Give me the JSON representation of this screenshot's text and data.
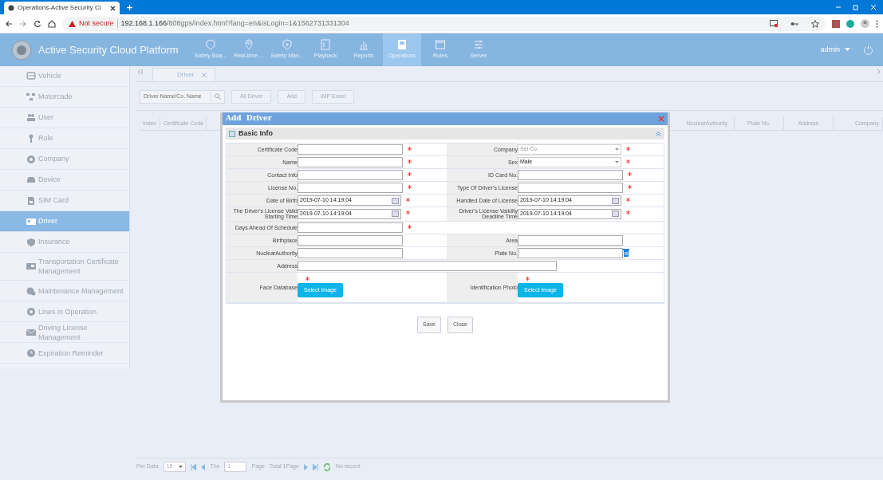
{
  "browser": {
    "tab_title": "Operations-Active Security Cl",
    "address": {
      "warning": "Not secure",
      "host": "192.168.1.166",
      "path": "/808gps/index.html?lang=en&isLogin=1&1562731331304"
    }
  },
  "app": {
    "title": "Active Security Cloud Platform",
    "user": "admin",
    "nav": [
      {
        "label": "Safety Boa...",
        "selected": false
      },
      {
        "label": "Real-time ...",
        "selected": false
      },
      {
        "label": "Safety Man...",
        "selected": false
      },
      {
        "label": "Playback",
        "selected": false
      },
      {
        "label": "Reports",
        "selected": false
      },
      {
        "label": "Operations",
        "selected": true
      },
      {
        "label": "Rules",
        "selected": false
      },
      {
        "label": "Server",
        "selected": false
      }
    ]
  },
  "sidebar": {
    "items": [
      {
        "label": "Vehicle",
        "selected": false
      },
      {
        "label": "Motorcade",
        "selected": false
      },
      {
        "label": "User",
        "selected": false
      },
      {
        "label": "Role",
        "selected": false
      },
      {
        "label": "Company",
        "selected": false
      },
      {
        "label": "Device",
        "selected": false
      },
      {
        "label": "SIM Card",
        "selected": false
      },
      {
        "label": "Driver",
        "selected": true
      },
      {
        "label": "Insurance",
        "selected": false
      },
      {
        "label": "Transportation Certificate Management",
        "selected": false
      },
      {
        "label": "Maintenance Management",
        "selected": false
      },
      {
        "label": "Lines in Operation",
        "selected": false
      },
      {
        "label": "Driving License Management",
        "selected": false
      },
      {
        "label": "Expiration Reminder",
        "selected": false
      }
    ]
  },
  "content_tab": {
    "label": "Driver"
  },
  "toolbar": {
    "search": {
      "placeholder": "Driver Name/Co. Name"
    },
    "buttons": [
      "All Driver",
      "Add",
      "IMP Excel"
    ]
  },
  "table": {
    "left_columns": [
      "Index",
      "Certificate Code"
    ],
    "right_columns": [
      "NuclearAuthority",
      "Plate No.",
      "Address",
      "Company"
    ]
  },
  "pager": {
    "per_data_label": "Per Data",
    "per_data": "15",
    "the_label": "The",
    "page": "1",
    "page_label": "Page",
    "total": "Total 1Page",
    "status": "No record"
  },
  "dialog": {
    "title": "Add  Driver",
    "section": "Basic Info",
    "rows": [
      [
        {
          "label": "Certificate Code",
          "kind": "text",
          "required": true
        },
        {
          "label": "Company",
          "kind": "select",
          "placeholder": "Sel Co.",
          "required": true
        }
      ],
      [
        {
          "label": "Name",
          "kind": "text",
          "required": true
        },
        {
          "label": "Sex",
          "kind": "select",
          "value": "Male",
          "required": true
        }
      ],
      [
        {
          "label": "Contact Info",
          "kind": "text",
          "required": true
        },
        {
          "label": "ID Card No.",
          "kind": "text",
          "required": true
        }
      ],
      [
        {
          "label": "License No.",
          "kind": "text",
          "required": true
        },
        {
          "label": "Type Of Driver's License",
          "kind": "text",
          "required": true
        }
      ],
      [
        {
          "label": "Date of Birth",
          "kind": "date",
          "value": "2019-07-10 14:19:04",
          "required": true
        },
        {
          "label": "Handled Date of License",
          "kind": "date",
          "value": "2019-07-10 14:19:04",
          "required": true
        }
      ],
      [
        {
          "label": "The Driver's License Valid Starting Time",
          "kind": "date",
          "value": "2019-07-10 14:19:04",
          "required": true
        },
        {
          "label": "Driver's License Validity Deadline Time",
          "kind": "date",
          "value": "2019-07-10 14:19:04",
          "required": true
        }
      ],
      [
        {
          "label": "Days Ahead Of Schedule",
          "kind": "text",
          "required": true
        }
      ],
      [
        {
          "label": "Birthplace",
          "kind": "text",
          "required": false
        },
        {
          "label": "Area",
          "kind": "text",
          "required": false
        }
      ],
      [
        {
          "label": "NuclearAuthority",
          "kind": "text",
          "required": false
        },
        {
          "label": "Plate No.",
          "kind": "clearable",
          "required": false
        }
      ],
      [
        {
          "label": "Address",
          "kind": "wide",
          "required": false
        }
      ],
      [
        {
          "label": "Face Database",
          "kind": "image",
          "button": "Select Image",
          "required": true
        },
        {
          "label": "Identification Photo",
          "kind": "image",
          "button": "Select Image",
          "required": true
        }
      ]
    ],
    "buttons": [
      "Save",
      "Close"
    ]
  }
}
